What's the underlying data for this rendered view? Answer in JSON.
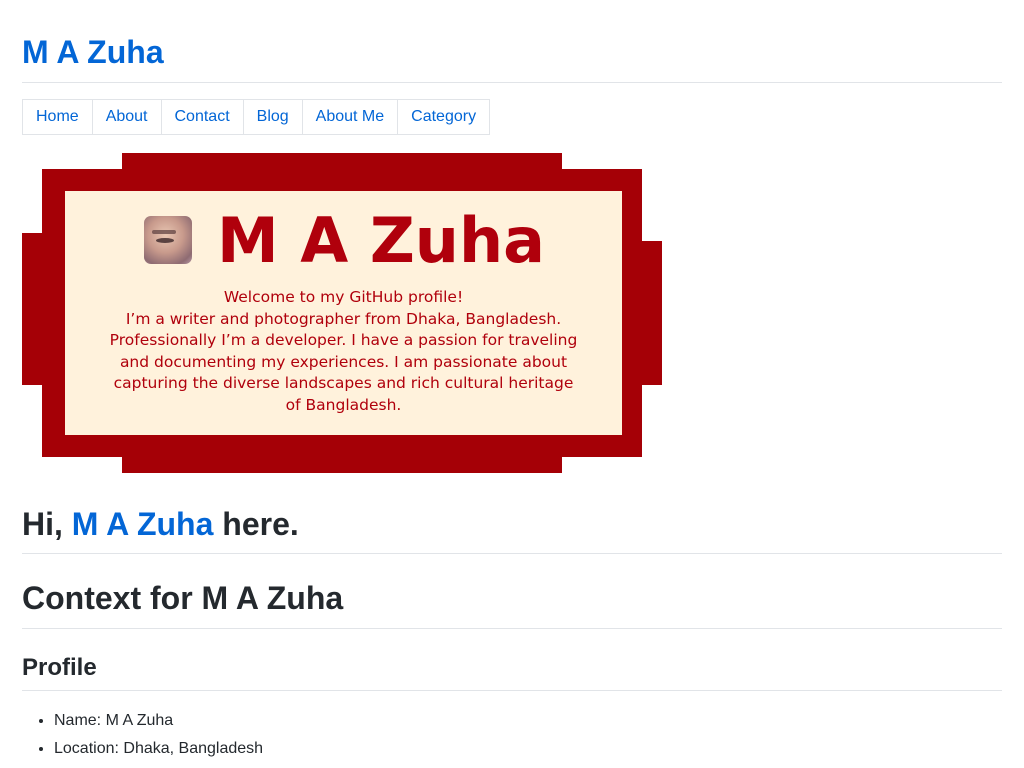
{
  "site": {
    "title": "M A Zuha"
  },
  "nav": {
    "items": [
      {
        "label": "Home"
      },
      {
        "label": "About"
      },
      {
        "label": "Contact"
      },
      {
        "label": "Blog"
      },
      {
        "label": "About Me"
      },
      {
        "label": "Category"
      }
    ]
  },
  "banner": {
    "name": "M A Zuha",
    "lines": [
      "Welcome to my GitHub profile!",
      "I’m a writer and photographer from Dhaka, Bangladesh.",
      "Professionally I’m a developer. I have a passion for traveling",
      "and documenting my experiences. I am passionate about",
      "capturing the diverse landscapes and rich cultural heritage",
      "of Bangladesh."
    ]
  },
  "intro": {
    "prefix": "Hi, ",
    "name": "M A Zuha",
    "suffix": " here."
  },
  "context": {
    "heading": "Context for M A Zuha"
  },
  "profile": {
    "heading": "Profile",
    "items": [
      "Name: M A Zuha",
      "Location: Dhaka, Bangladesh"
    ]
  },
  "colors": {
    "link": "#0366d6",
    "banner_red": "#a50006",
    "banner_text": "#b0000c",
    "banner_panel": "#fff2dc"
  }
}
